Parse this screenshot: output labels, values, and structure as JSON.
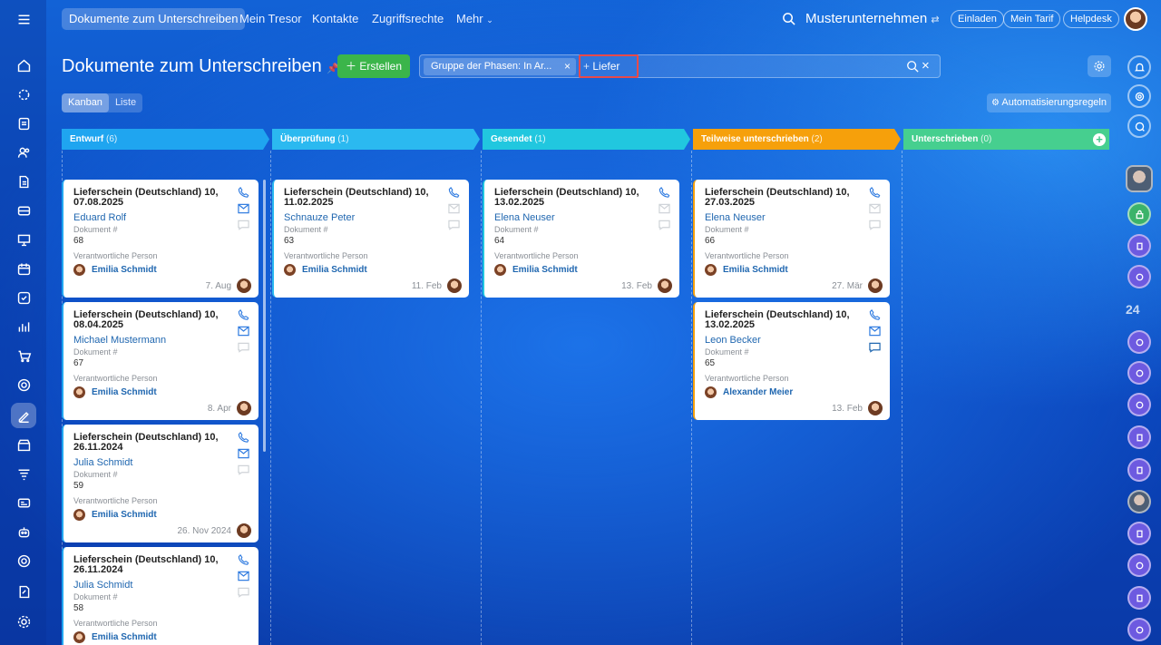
{
  "nav": {
    "tabs": [
      "Dokumente zum Unterschreiben",
      "Mein Tresor",
      "Kontakte",
      "Zugriffsrechte",
      "Mehr"
    ],
    "company": "Musterunternehmen",
    "invite": "Einladen",
    "tariff": "Mein Tarif",
    "helpdesk": "Helpdesk"
  },
  "page": {
    "title": "Dokumente zum Unterschreiben",
    "create": "Erstellen",
    "filter_chip": "Gruppe der Phasen: In Ar...",
    "search_value": "Liefer",
    "view_kanban": "Kanban",
    "view_list": "Liste",
    "automation": "Automatisierungsregeln"
  },
  "labels": {
    "doc_no": "Dokument #",
    "responsible": "Verantwortliche Person"
  },
  "stages": [
    {
      "name": "Entwurf",
      "count": "(6)",
      "color": "#1fa5f0"
    },
    {
      "name": "Überprüfung",
      "count": "(1)",
      "color": "#2bb9f0"
    },
    {
      "name": "Gesendet",
      "count": "(1)",
      "color": "#21c7df"
    },
    {
      "name": "Teilweise unterschrieben",
      "count": "(2)",
      "color": "#f6a00b"
    },
    {
      "name": "Unterschrieben",
      "count": "(0)",
      "color": "#46cf8f"
    }
  ],
  "cards": [
    {
      "title": "Lieferschein (Deutschland) 10, 07.08.2025",
      "client": "Eduard Rolf",
      "number": "68",
      "responsible": "Emilia Schmidt",
      "date": "7. Aug"
    },
    {
      "title": "Lieferschein (Deutschland) 10, 08.04.2025",
      "client": "Michael Mustermann",
      "number": "67",
      "responsible": "Emilia Schmidt",
      "date": "8. Apr"
    },
    {
      "title": "Lieferschein (Deutschland) 10, 26.11.2024",
      "client": "Julia Schmidt",
      "number": "59",
      "responsible": "Emilia Schmidt",
      "date": "26. Nov 2024"
    },
    {
      "title": "Lieferschein (Deutschland) 10, 26.11.2024",
      "client": "Julia Schmidt",
      "number": "58",
      "responsible": "Emilia Schmidt",
      "date": ""
    },
    {
      "title": "Lieferschein (Deutschland) 10, 11.02.2025",
      "client": "Schnauze Peter",
      "number": "63",
      "responsible": "Emilia Schmidt",
      "date": "11. Feb"
    },
    {
      "title": "Lieferschein (Deutschland) 10, 13.02.2025",
      "client": "Elena Neuser",
      "number": "64",
      "responsible": "Emilia Schmidt",
      "date": "13. Feb"
    },
    {
      "title": "Lieferschein (Deutschland) 10, 27.03.2025",
      "client": "Elena Neuser",
      "number": "66",
      "responsible": "Emilia Schmidt",
      "date": "27. Mär"
    },
    {
      "title": "Lieferschein (Deutschland) 10, 13.02.2025",
      "client": "Leon Becker",
      "number": "65",
      "responsible": "Alexander Meier",
      "date": "13. Feb"
    }
  ],
  "right_counter": "24"
}
